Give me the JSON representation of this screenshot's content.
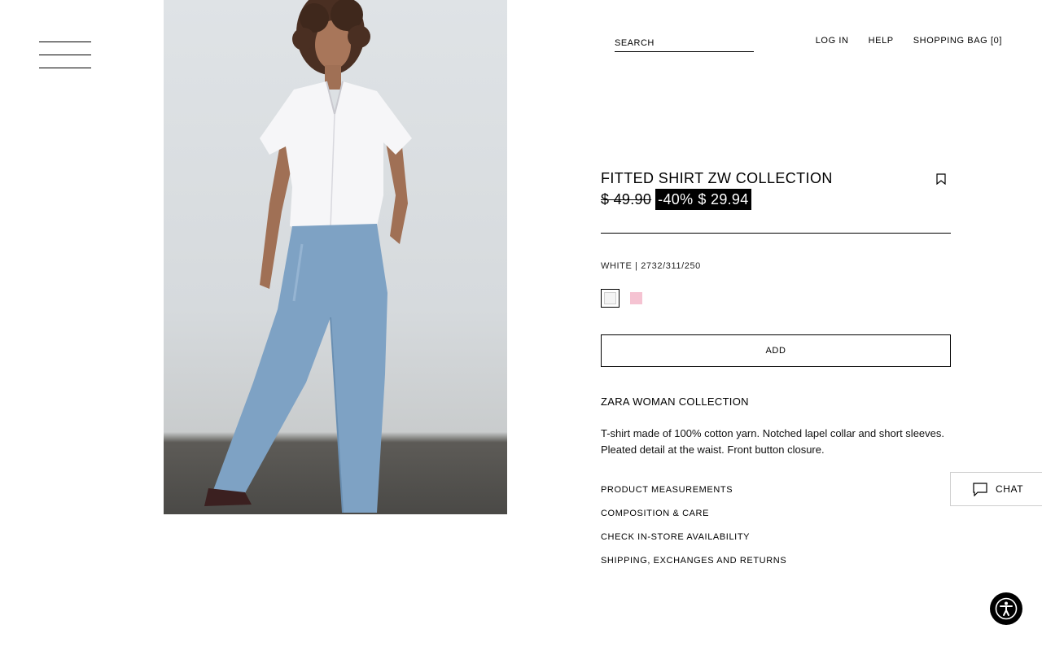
{
  "header": {
    "menu_label": "",
    "search_placeholder": "SEARCH",
    "nav": {
      "login": "LOG IN",
      "help": "HELP",
      "bag": "SHOPPING BAG [0]"
    }
  },
  "product": {
    "title": "FITTED SHIRT ZW COLLECTION",
    "old_price": "$ 49.90",
    "discount": "-40%",
    "sale_price": "$ 29.94",
    "color_ref": "WHITE | 2732/311/250",
    "swatches": [
      {
        "name": "white",
        "color": "#f4f4f4",
        "selected": true
      },
      {
        "name": "pink",
        "color": "#f5c3d2",
        "selected": false
      }
    ],
    "add_label": "ADD",
    "collection": "ZARA WOMAN COLLECTION",
    "description": "T-shirt made of 100% cotton yarn. Notched lapel collar and short sleeves. Pleated detail at the waist. Front button closure.",
    "links": [
      "PRODUCT MEASUREMENTS",
      "COMPOSITION & CARE",
      "CHECK IN-STORE AVAILABILITY",
      "SHIPPING, EXCHANGES AND RETURNS"
    ]
  },
  "chat": {
    "label": "CHAT"
  },
  "icons": {
    "menu": "hamburger-icon",
    "bookmark": "bookmark-icon",
    "chat": "chat-bubble-icon",
    "accessibility": "accessibility-icon"
  },
  "colors": {
    "sale_bg": "#000000",
    "sale_text": "#ffffff",
    "accent": "#000000"
  }
}
